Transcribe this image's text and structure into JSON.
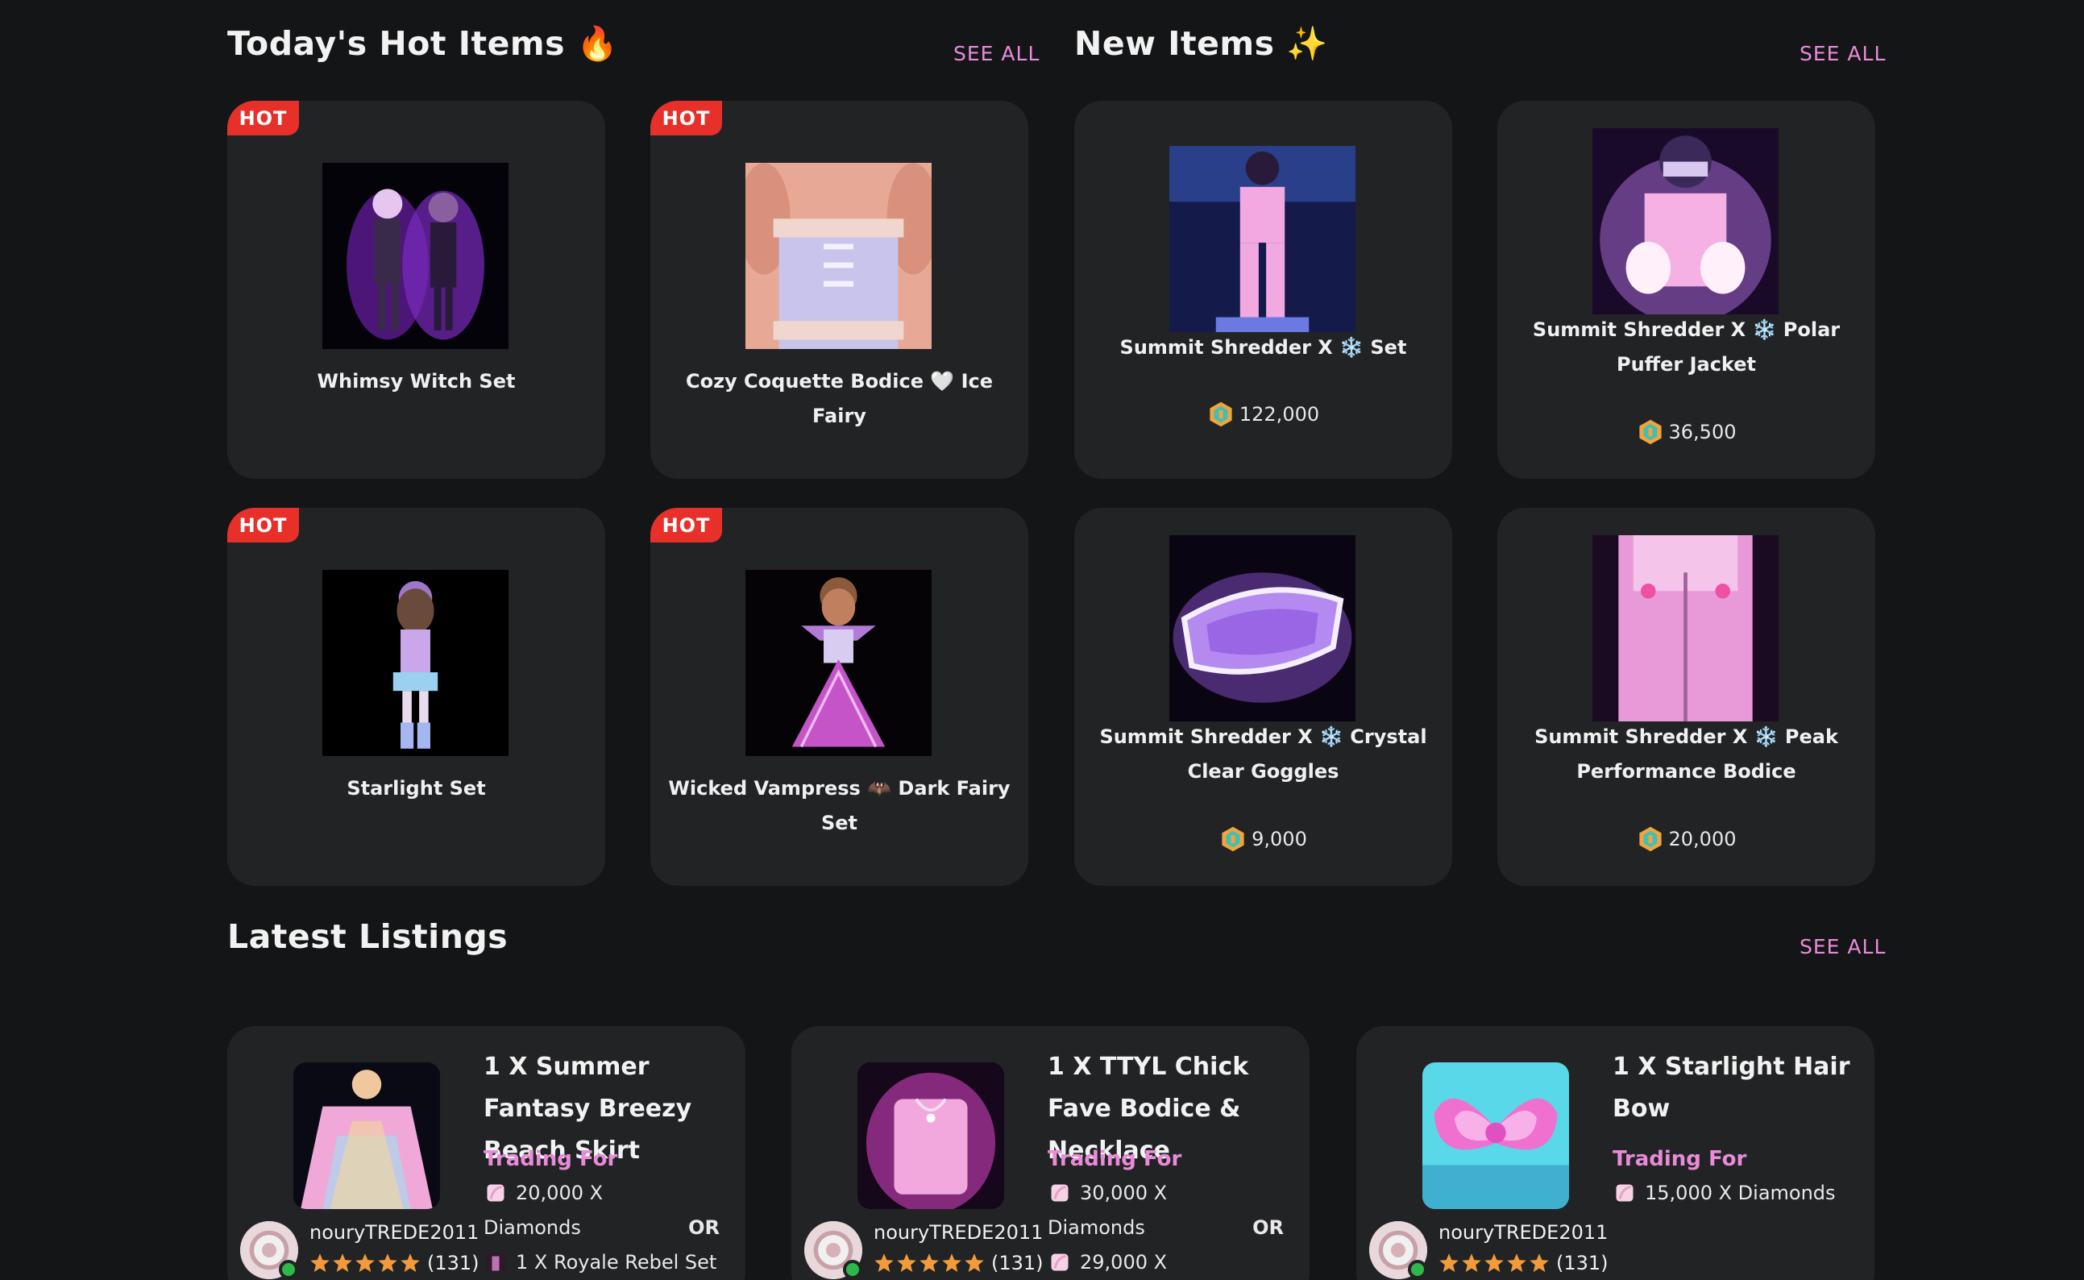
{
  "hot_section": {
    "title": "Today's Hot Items",
    "title_emoji": "🔥",
    "see_all": "SEE ALL",
    "badge": "HOT",
    "items": [
      {
        "name": "Whimsy Witch Set"
      },
      {
        "name": "Cozy Coquette Bodice 🤍 Ice Fairy"
      },
      {
        "name": "Starlight Set"
      },
      {
        "name": "Wicked Vampress 🦇 Dark Fairy Set"
      }
    ]
  },
  "new_section": {
    "title": "New Items",
    "title_emoji": "✨",
    "see_all": "SEE ALL",
    "items": [
      {
        "name": "Summit Shredder X ❄️ Set",
        "price": "122,000"
      },
      {
        "name": "Summit Shredder X ❄️ Polar Puffer Jacket",
        "price": "36,500"
      },
      {
        "name": "Summit Shredder X ❄️ Crystal Clear Goggles",
        "price": "9,000"
      },
      {
        "name": "Summit Shredder X ❄️ Peak Performance Bodice",
        "price": "20,000"
      }
    ]
  },
  "listings_section": {
    "title": "Latest Listings",
    "see_all": "SEE ALL",
    "trading_for_label": "Trading For",
    "or_label": "OR",
    "listings": [
      {
        "title": "1 X Summer Fantasy Breezy Beach Skirt",
        "offer1": "20,000 X",
        "offer1_cont": "Diamonds",
        "offer2": "1 X Royale Rebel Set",
        "seller": "nouryTREDE2011",
        "rating_count": "(131)",
        "rating": 5
      },
      {
        "title": "1 X TTYL Chick Fave Bodice & Necklace",
        "offer1": "30,000 X",
        "offer1_cont": "Diamonds",
        "offer2": "29,000 X",
        "seller": "nouryTREDE2011",
        "rating_count": "(131)",
        "rating": 5
      },
      {
        "title": "1 X Starlight Hair Bow",
        "offer1": "15,000 X Diamonds",
        "seller": "nouryTREDE2011",
        "rating_count": "(131)",
        "rating": 5
      }
    ]
  },
  "colors": {
    "background": "#141517",
    "card": "#222325",
    "accent_pink": "#e88bd8",
    "hot_badge": "#e8302a",
    "online": "#2fb84a",
    "star": "#f39a3a"
  }
}
